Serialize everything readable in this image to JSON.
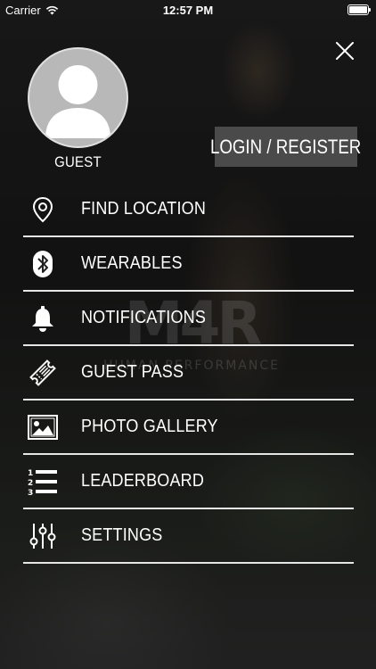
{
  "status_bar": {
    "carrier": "Carrier",
    "time": "12:57 PM"
  },
  "watermark": {
    "logo": "M4R",
    "tagline": "HUMAN PERFORMANCE"
  },
  "profile": {
    "name": "GUEST",
    "login_label": "LOGIN / REGISTER"
  },
  "menu": {
    "items": [
      {
        "label": "FIND LOCATION",
        "icon": "location-pin-icon"
      },
      {
        "label": "WEARABLES",
        "icon": "bluetooth-icon"
      },
      {
        "label": "NOTIFICATIONS",
        "icon": "bell-icon"
      },
      {
        "label": "GUEST PASS",
        "icon": "ticket-icon"
      },
      {
        "label": "PHOTO GALLERY",
        "icon": "image-icon"
      },
      {
        "label": "LEADERBOARD",
        "icon": "numbered-list-icon"
      },
      {
        "label": "SETTINGS",
        "icon": "sliders-icon"
      }
    ]
  },
  "colors": {
    "text": "#ffffff",
    "divider": "#e6e6e6",
    "login_bg": "#4a4a4a",
    "avatar_bg": "#b8b8b8"
  }
}
